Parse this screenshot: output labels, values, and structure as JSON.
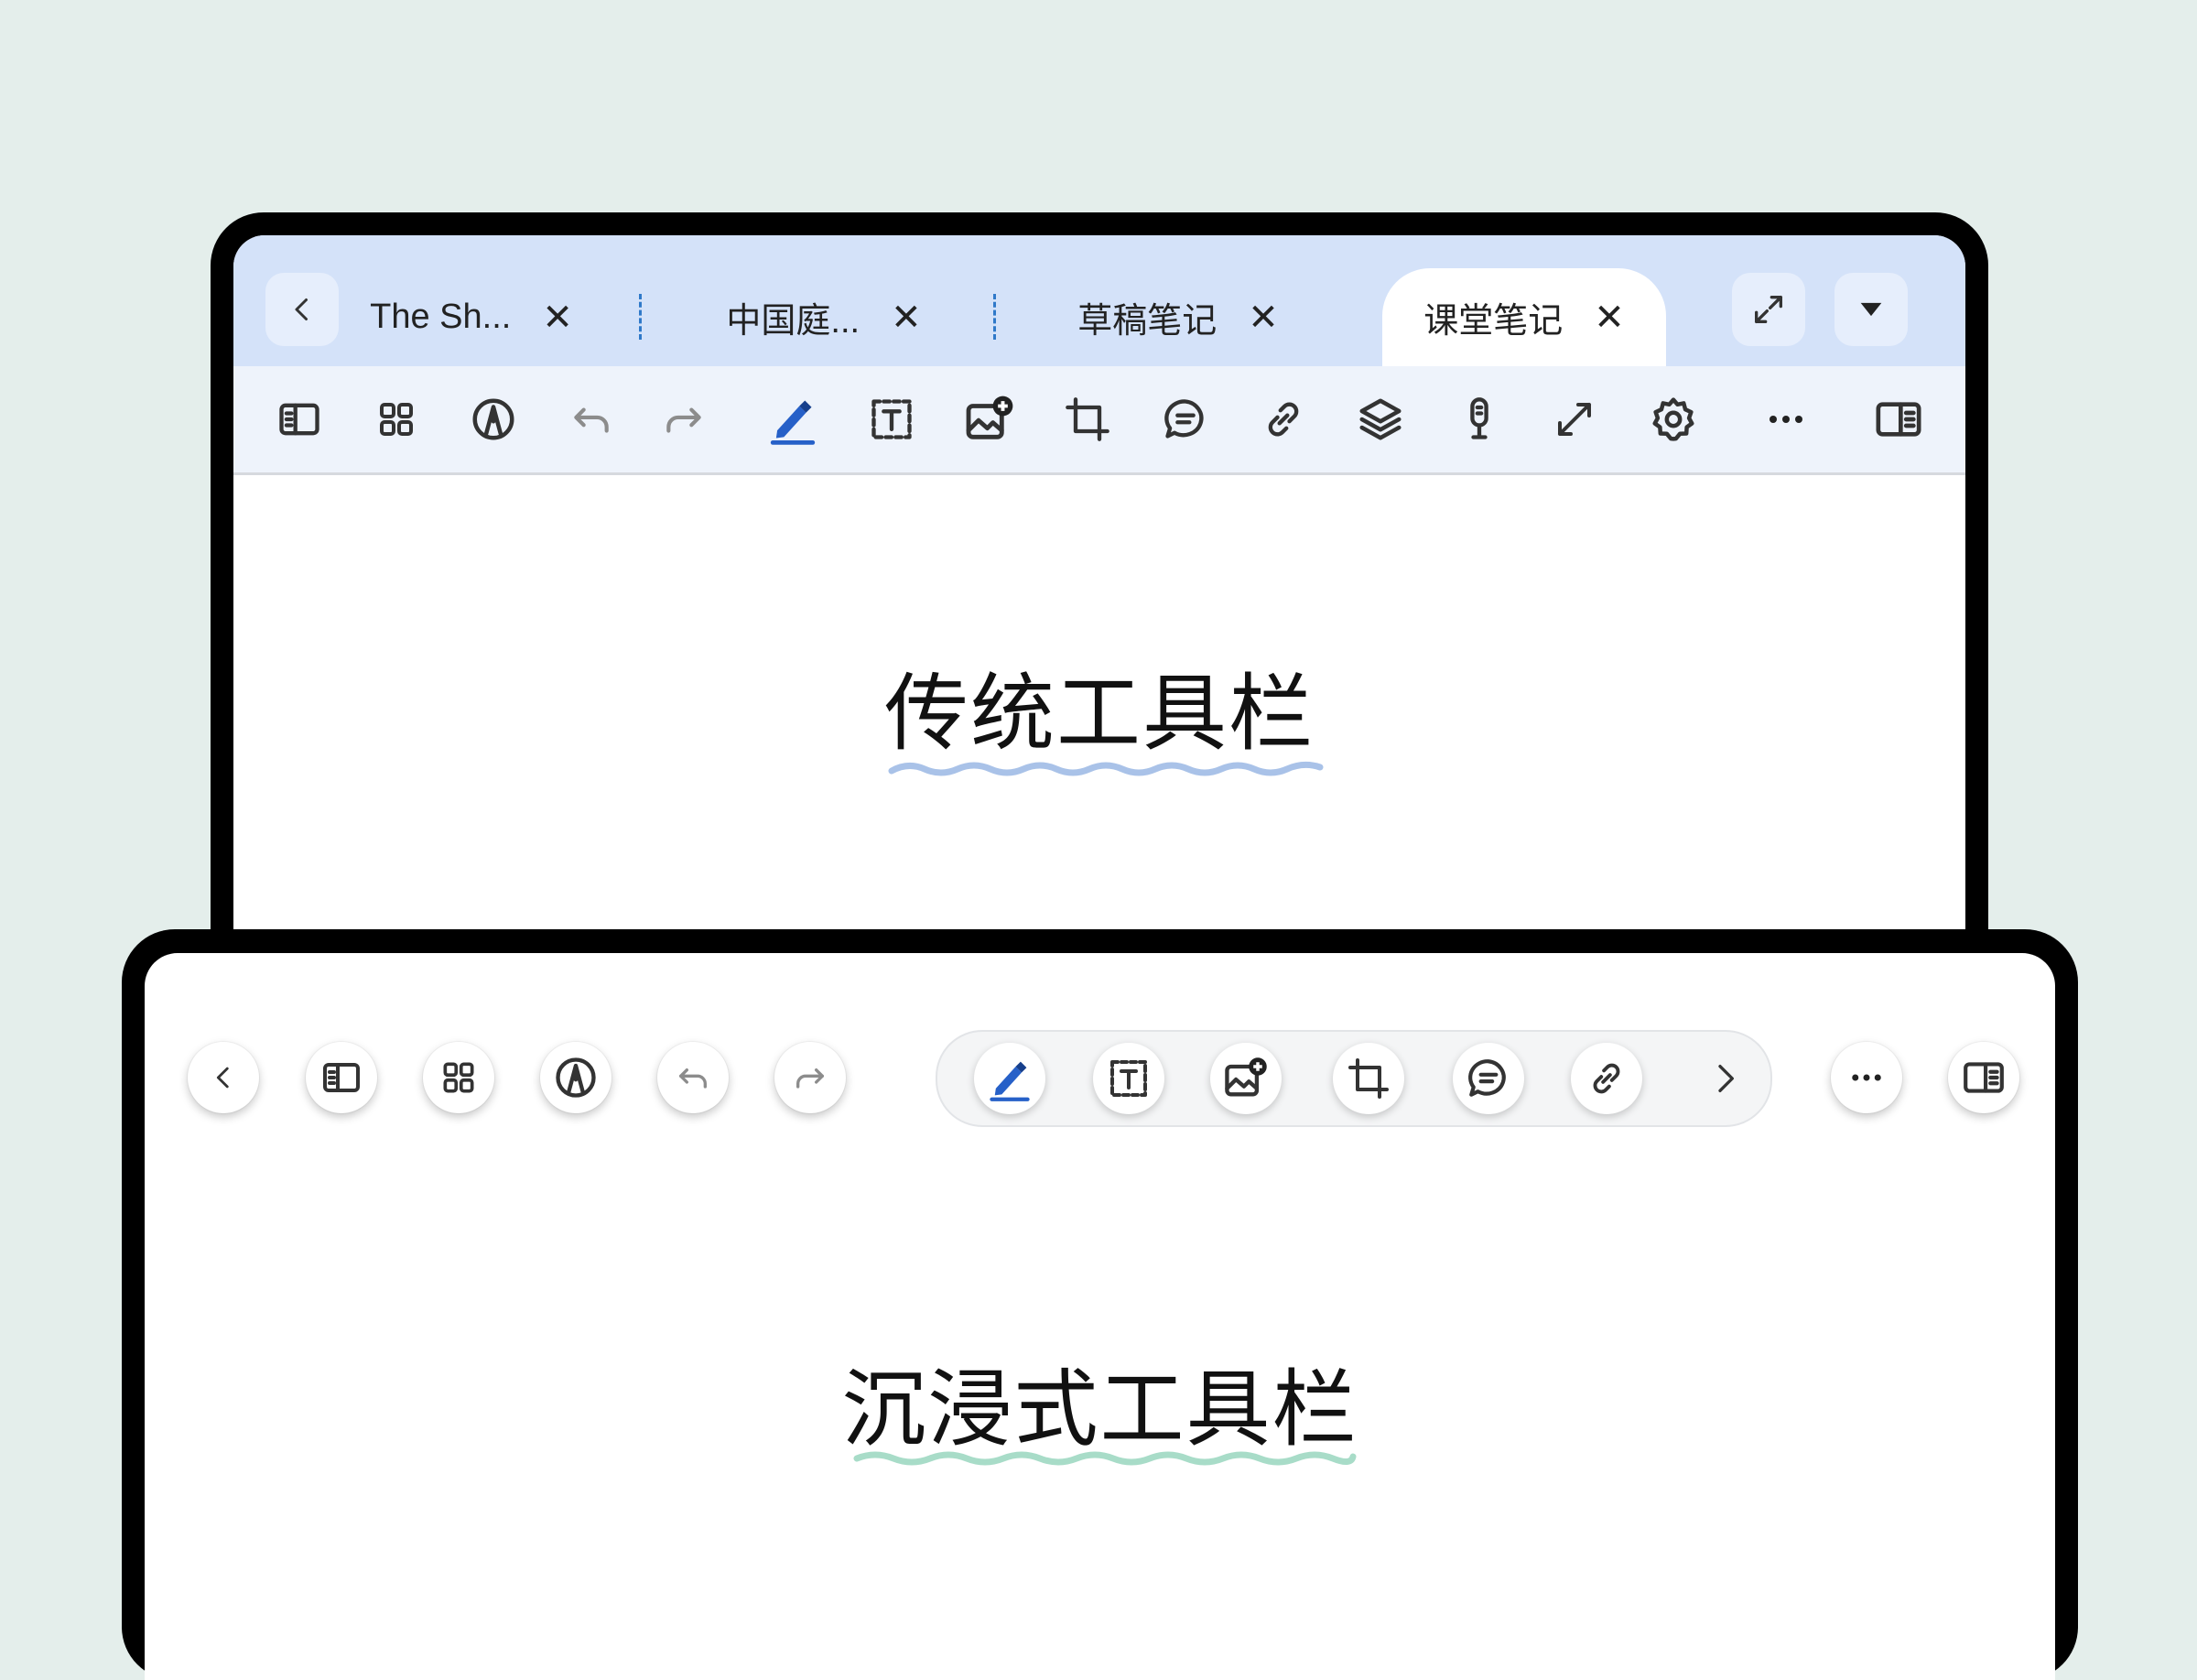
{
  "traditional": {
    "tabs": [
      {
        "label": "The Sh...",
        "active": false
      },
      {
        "label": "中国庭...",
        "active": false
      },
      {
        "label": "草稿笔记",
        "active": false
      },
      {
        "label": "课堂笔记",
        "active": true
      }
    ],
    "tab_close_glyph": "✕",
    "heading": "传统工具栏",
    "underline_color": "#a9c2e8",
    "toolbar_icons": [
      "sidebar-icon",
      "grid-icon",
      "pen-nib-icon",
      "undo-icon",
      "redo-icon",
      "pen-icon",
      "text-box-icon",
      "add-image-icon",
      "crop-icon",
      "comment-icon",
      "link-icon",
      "layers-icon",
      "microphone-icon",
      "expand-icon",
      "settings-icon",
      "more-icon",
      "right-panel-icon"
    ]
  },
  "immersive": {
    "heading": "沉浸式工具栏",
    "underline_color": "#a8dcc8",
    "left_icons": [
      "back-icon",
      "sidebar-icon",
      "grid-icon",
      "pen-nib-icon",
      "undo-icon",
      "redo-icon"
    ],
    "pill_icons": [
      "pen-icon",
      "text-box-icon",
      "add-image-icon",
      "crop-icon",
      "comment-icon",
      "link-icon",
      "chevron-right-icon"
    ],
    "right_icons": [
      "more-icon",
      "right-panel-icon"
    ]
  },
  "colors": {
    "background": "#e4eeeb",
    "tabbar": "#d4e2f9",
    "accent_blue": "#2660c8",
    "tab_separator": "#2f79c9"
  }
}
